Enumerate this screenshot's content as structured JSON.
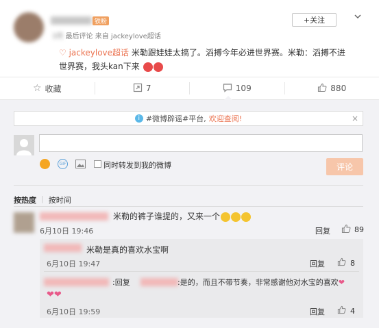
{
  "post": {
    "username": "█████",
    "vip_badge": "铁粉",
    "time_blurred": "3月",
    "source_prefix": "最后评论",
    "source_from": "来自 jackeylove超话",
    "follow_label": "+关注",
    "topic_link": "jackeylove超话",
    "content_line1": "米勒跟娃娃太搞了。滔搏今年必进世界赛。米勒：滔搏不进",
    "content_line2": "世界赛，我头kan下来"
  },
  "actions": {
    "favorite_label": "收藏",
    "repost_count": "7",
    "comment_count": "109",
    "like_count": "880"
  },
  "notice": {
    "text_prefix": "#微博辟谣#平台,",
    "text_link": "欢迎查阅!",
    "close": "×"
  },
  "composer": {
    "placeholder": "",
    "repost_checkbox_label": "同时转发到我的微博",
    "submit_label": "评论"
  },
  "sort": {
    "by_hot": "按热度",
    "by_time": "按时间"
  },
  "comments": [
    {
      "text": "米勒的裤子谁提的，又来一个",
      "time": "6月10日 19:46",
      "reply_label": "回复",
      "likes": "89"
    }
  ],
  "replies": [
    {
      "text": "米勒是真的喜欢水宝啊",
      "time": "6月10日 19:47",
      "reply_label": "回复",
      "likes": "8"
    },
    {
      "prefix": ":回复",
      "text": ":是的，而且不带节奏，非常感谢他对水宝的喜欢",
      "time": "6月10日 19:59",
      "reply_label": "回复",
      "likes": "4"
    }
  ]
}
